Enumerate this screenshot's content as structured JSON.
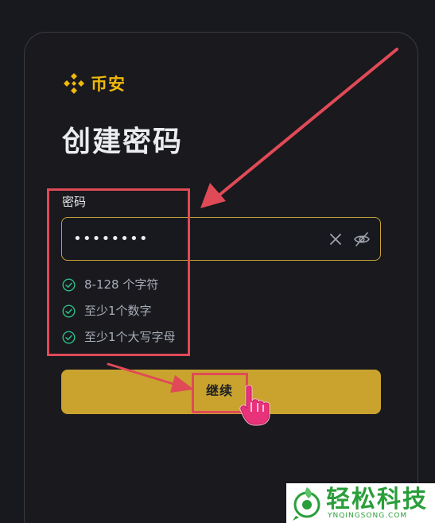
{
  "brand": {
    "logo_text": "币安",
    "accent_color": "#f0b90b",
    "logo_icon": "binance-diamond-icon"
  },
  "page": {
    "title": "创建密码"
  },
  "password_field": {
    "label": "密码",
    "value": "••••••••",
    "clear_icon": "close-icon",
    "visibility_icon": "eye-off-icon"
  },
  "requirements": [
    {
      "text": "8-128 个字符",
      "status": "satisfied",
      "icon": "check-circle-icon"
    },
    {
      "text": "至少1个数字",
      "status": "satisfied",
      "icon": "check-circle-icon"
    },
    {
      "text": "至少1个大写字母",
      "status": "satisfied",
      "icon": "check-circle-icon"
    }
  ],
  "actions": {
    "continue_label": "继续",
    "button_color": "#c9a32e"
  },
  "annotations": {
    "highlight_color": "#e04a57",
    "cursor_icon": "hand-pointer-icon"
  },
  "watermark": {
    "name": "轻松科技",
    "url": "YNQINGSONG.COM",
    "color": "#2a9e3a"
  }
}
